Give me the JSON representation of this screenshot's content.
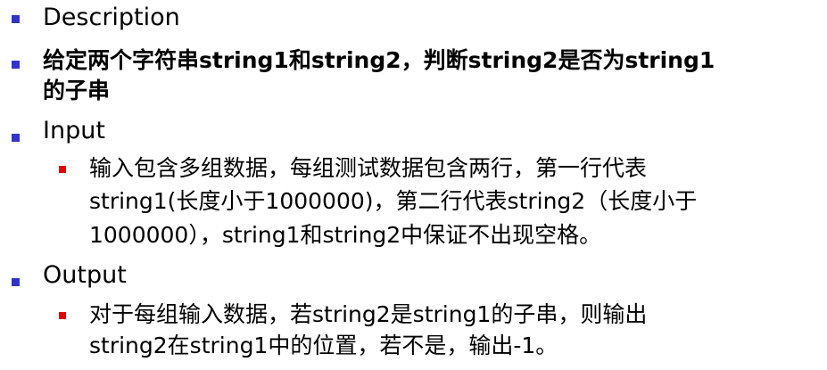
{
  "colors": {
    "level1_bullet": "#3333cc",
    "level2_bullet": "#e00000",
    "text": "#000000"
  },
  "items": {
    "description_heading": "Description",
    "problem_line1": "给定两个字符串string1和string2，判断string2是否为string1",
    "problem_line2": "的子串",
    "input_heading": "Input",
    "input_line1": "输入包含多组数据，每组测试数据包含两行，第一行代表",
    "input_line2": "string1(长度小于1000000)，第二行代表string2（长度小于",
    "input_line3": "1000000），string1和string2中保证不出现空格。",
    "output_heading": "Output",
    "output_line1": "对于每组输入数据，若string2是string1的子串，则输出",
    "output_line2": "string2在string1中的位置，若不是，输出-1。"
  }
}
